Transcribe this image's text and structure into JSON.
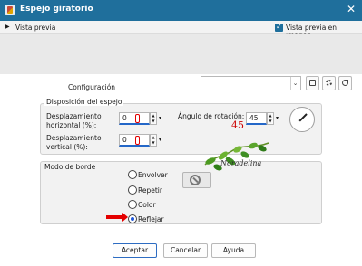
{
  "window": {
    "title": "Espejo giratorio",
    "close": "✕"
  },
  "preview": {
    "label": "Vista previa",
    "image_label": "Vista previa en imagen",
    "checked": true
  },
  "settings": {
    "config_label": "Configuración",
    "preset_value": ""
  },
  "mirror_layout": {
    "title": "Disposición del espejo",
    "horizontal_label": "Desplazamiento horizontal (%):",
    "horizontal_value": "0",
    "vertical_label": "Desplazamiento vertical (%):",
    "vertical_value": "0",
    "angle_label": "Ángulo de rotación:",
    "angle_value": "45",
    "angle_annotation": "45"
  },
  "edge_mode": {
    "title": "Modo de borde",
    "options": [
      {
        "label": "Envolver",
        "selected": false
      },
      {
        "label": "Repetir",
        "selected": false
      },
      {
        "label": "Color",
        "selected": false
      },
      {
        "label": "Reflejar",
        "selected": true
      }
    ]
  },
  "watermark": {
    "text": "Noradelina"
  },
  "buttons": {
    "accept": "Aceptar",
    "cancel": "Cancelar",
    "help": "Ayuda"
  },
  "colors": {
    "titlebar": "#1f6f9c",
    "highlight": "#e40000",
    "active": "#2467c8"
  }
}
